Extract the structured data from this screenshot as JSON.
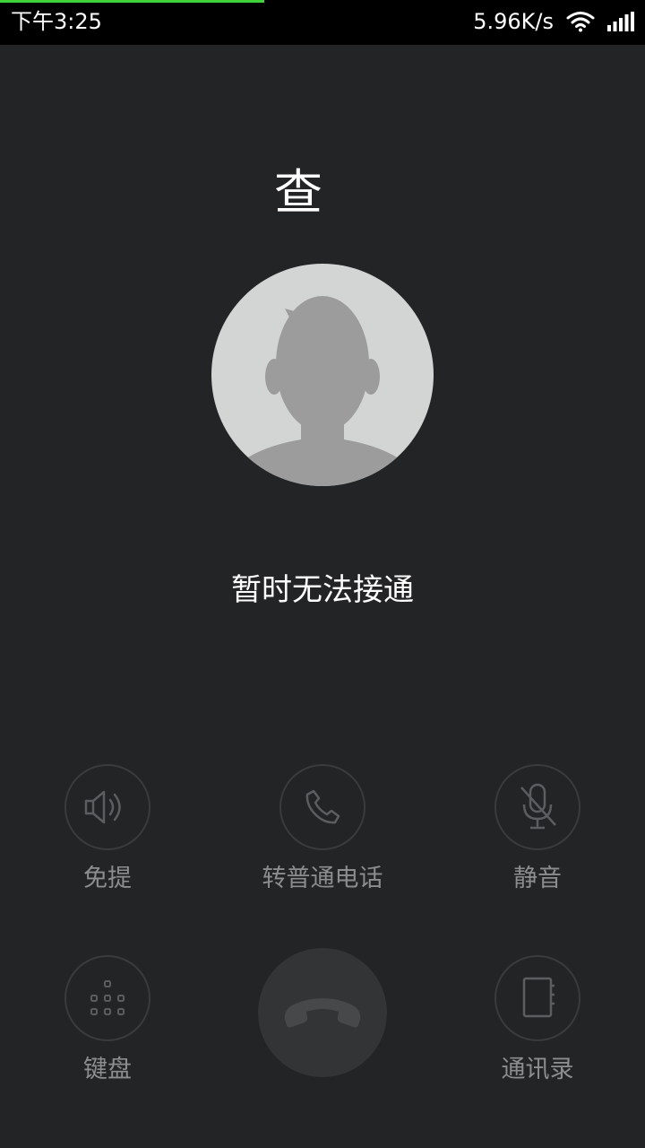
{
  "status_bar": {
    "time": "下午3:25",
    "net_speed": "5.96K/s",
    "icons": [
      "wifi-icon",
      "signal-icon"
    ],
    "progress_color": "#3fd23a"
  },
  "contact": {
    "name": "查",
    "avatar_icon": "default-avatar-icon",
    "call_status": "暂时无法接通"
  },
  "controls": {
    "speaker": {
      "label": "免提",
      "icon": "speaker-icon"
    },
    "switch_to_regular_call": {
      "label": "转普通电话",
      "icon": "phone-icon"
    },
    "mute": {
      "label": "静音",
      "icon": "mic-off-icon"
    },
    "keypad": {
      "label": "键盘",
      "icon": "dialpad-icon"
    },
    "hang_up": {
      "icon": "hang-up-icon"
    },
    "contacts": {
      "label": "通讯录",
      "icon": "contacts-book-icon"
    }
  },
  "colors": {
    "background": "#232426",
    "label": "#8c8d8f",
    "icon": "#5c5d60"
  }
}
